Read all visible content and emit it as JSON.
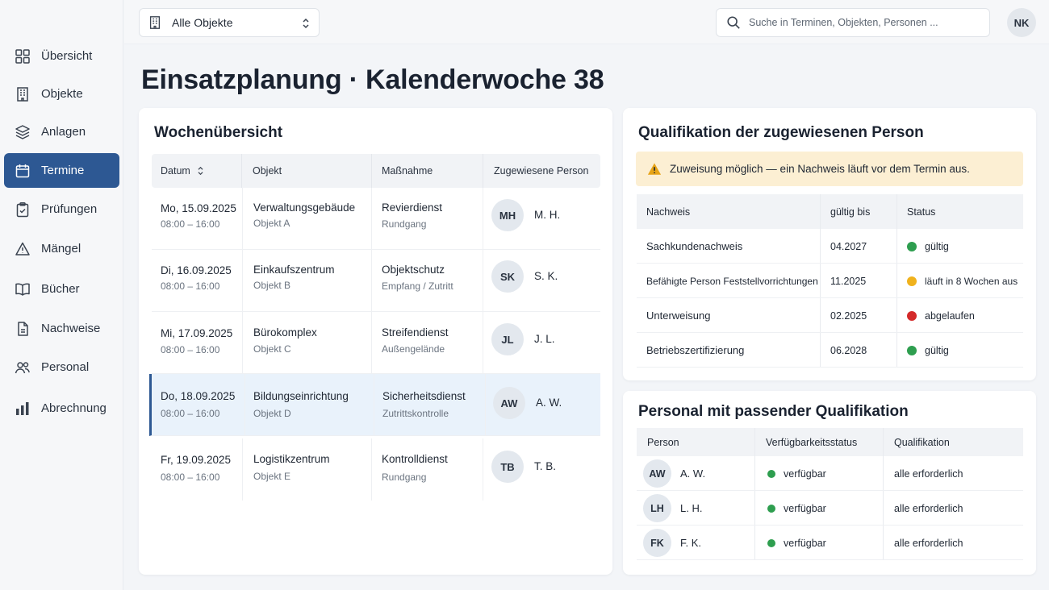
{
  "sidebar": {
    "items": [
      {
        "label": "Übersicht",
        "icon": "grid-icon"
      },
      {
        "label": "Objekte",
        "icon": "building-icon"
      },
      {
        "label": "Anlagen",
        "icon": "layers-icon"
      },
      {
        "label": "Termine",
        "icon": "calendar-icon",
        "active": true
      },
      {
        "label": "Prüfungen",
        "icon": "clipboard-check-icon"
      },
      {
        "label": "Mängel",
        "icon": "warning-triangle-icon"
      },
      {
        "label": "Bücher",
        "icon": "book-icon"
      },
      {
        "label": "Nachweise",
        "icon": "document-icon"
      },
      {
        "label": "Personal",
        "icon": "users-icon"
      },
      {
        "label": "Abrechnung",
        "icon": "bar-chart-icon"
      }
    ]
  },
  "topbar": {
    "object_select": "Alle Objekte",
    "search_placeholder": "Suche in Terminen, Objekten, Personen ...",
    "user_initials": "NK"
  },
  "page": {
    "title": "Einsatzplanung · Kalenderwoche 38"
  },
  "week": {
    "title": "Wochenübersicht",
    "columns": [
      "Datum",
      "Objekt",
      "Maßnahme",
      "Zugewiesene Person"
    ],
    "rows": [
      {
        "date": "Mo, 15.09.2025",
        "time": "08:00 – 16:00",
        "object": "Verwaltungsgebäude",
        "object_sub": "Objekt A",
        "measure": "Revierdienst",
        "measure_sub": "Rundgang",
        "initials": "MH",
        "person": "M. H."
      },
      {
        "date": "Di, 16.09.2025",
        "time": "08:00 – 16:00",
        "object": "Einkaufszentrum",
        "object_sub": "Objekt B",
        "measure": "Objektschutz",
        "measure_sub": "Empfang / Zutritt",
        "initials": "SK",
        "person": "S. K."
      },
      {
        "date": "Mi, 17.09.2025",
        "time": "08:00 – 16:00",
        "object": "Bürokomplex",
        "object_sub": "Objekt C",
        "measure": "Streifendienst",
        "measure_sub": "Außengelände",
        "initials": "JL",
        "person": "J. L."
      },
      {
        "date": "Do, 18.09.2025",
        "time": "08:00 – 16:00",
        "object": "Bildungseinrichtung",
        "object_sub": "Objekt D",
        "measure": "Sicherheitsdienst",
        "measure_sub": "Zutrittskontrolle",
        "initials": "AW",
        "person": "A. W.",
        "selected": true
      },
      {
        "date": "Fr, 19.09.2025",
        "time": "08:00 – 16:00",
        "object": "Logistikzentrum",
        "object_sub": "Objekt E",
        "measure": "Kontrolldienst",
        "measure_sub": "Rundgang",
        "initials": "TB",
        "person": "T. B."
      }
    ]
  },
  "qualification": {
    "title": "Qualifikation der zugewiesenen Person",
    "warning": "Zuweisung möglich — ein Nachweis läuft vor dem Termin aus.",
    "columns": [
      "Nachweis",
      "gültig bis",
      "Status"
    ],
    "rows": [
      {
        "name": "Sachkundenachweis",
        "valid_until": "04.2027",
        "status": "gültig",
        "color": "#2e9e4f"
      },
      {
        "name": "Befähigte Person Feststellvorrichtungen",
        "valid_until": "11.2025",
        "status": "läuft in 8 Wochen aus",
        "color": "#f0b21d"
      },
      {
        "name": "Unterweisung",
        "valid_until": "02.2025",
        "status": "abgelaufen",
        "color": "#d42a2a"
      },
      {
        "name": "Betriebszertifizierung",
        "valid_until": "06.2028",
        "status": "gültig",
        "color": "#2e9e4f"
      }
    ]
  },
  "staff": {
    "title": "Personal mit passender Qualifikation",
    "columns": [
      "Person",
      "Verfügbarkeitsstatus",
      "Qualifikation"
    ],
    "rows": [
      {
        "initials": "AW",
        "name": "A. W.",
        "availability": "verfügbar",
        "qualification": "alle erforderlich"
      },
      {
        "initials": "LH",
        "name": "L. H.",
        "availability": "verfügbar",
        "qualification": "alle erforderlich"
      },
      {
        "initials": "FK",
        "name": "F. K.",
        "availability": "verfügbar",
        "qualification": "alle erforderlich"
      }
    ]
  },
  "colors": {
    "accent": "#2d5893",
    "available": "#2e9e4f",
    "warning_bg": "#fcefd3",
    "warning_icon": "#e7a417"
  }
}
